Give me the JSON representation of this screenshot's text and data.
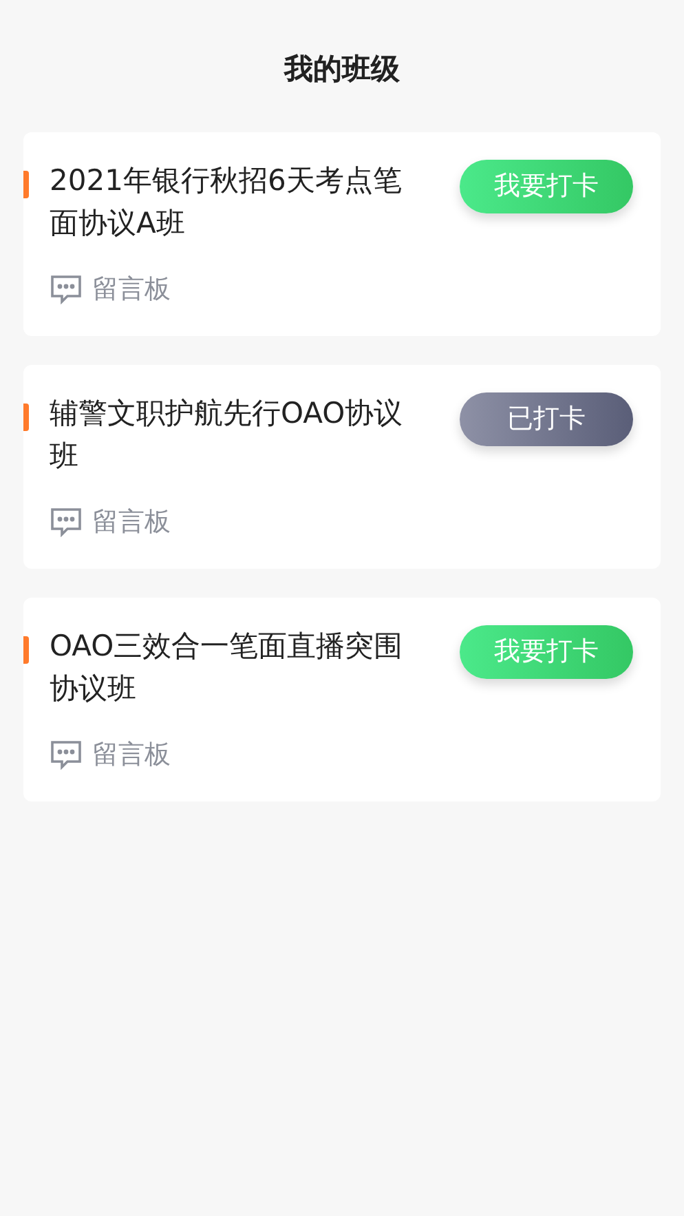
{
  "header": {
    "title": "我的班级"
  },
  "classes": [
    {
      "name": "2021年银行秋招6天考点笔面协议A班",
      "checked_in": false,
      "action": "我要打卡",
      "board": "留言板"
    },
    {
      "name": "辅警文职护航先行OAO协议班",
      "checked_in": true,
      "action": "已打卡",
      "board": "留言板"
    },
    {
      "name": "OAO三效合一笔面直播突围协议班",
      "checked_in": false,
      "action": "我要打卡",
      "board": "留言板"
    }
  ]
}
